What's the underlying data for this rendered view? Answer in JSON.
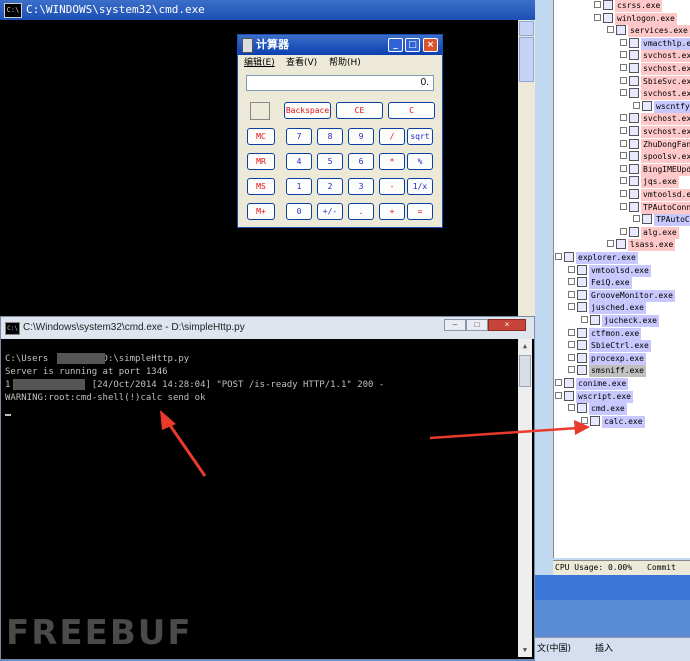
{
  "cmd_top": {
    "title": "C:\\WINDOWS\\system32\\cmd.exe"
  },
  "calculator": {
    "title": "计算器",
    "menus": [
      "编辑(E)",
      "查看(V)",
      "帮助(H)"
    ],
    "display": "0.",
    "top_buttons": [
      "Backspace",
      "CE",
      "C"
    ],
    "rows": [
      [
        "MC",
        "7",
        "8",
        "9",
        "/",
        "sqrt"
      ],
      [
        "MR",
        "4",
        "5",
        "6",
        "*",
        "%"
      ],
      [
        "MS",
        "1",
        "2",
        "3",
        "-",
        "1/x"
      ],
      [
        "M+",
        "0",
        "+/-",
        ".",
        "+",
        "="
      ]
    ],
    "red_buttons": [
      "MC",
      "MR",
      "MS",
      "M+",
      "Backspace",
      "CE",
      "C",
      "/",
      "*",
      "-",
      "+",
      "="
    ]
  },
  "cmd_bottom": {
    "title": "C:\\Windows\\system32\\cmd.exe - D:\\simpleHttp.py",
    "lines": [
      "C:\\Users          D:\\simpleHttp.py",
      "Server is running at port 1346",
      "1           - - [24/Oct/2014 14:28:04] \"POST /is-ready HTTP/1.1\" 200 -",
      "WARNING:root:cmd-shell(!)calc send ok"
    ]
  },
  "process_tree": {
    "items": [
      {
        "name": "csrss.exe",
        "indent": 4,
        "bg": "pink"
      },
      {
        "name": "winlogon.exe",
        "indent": 4,
        "bg": "pink"
      },
      {
        "name": "services.exe",
        "indent": 5,
        "bg": "pink"
      },
      {
        "name": "vmacthlp.exe",
        "indent": 6,
        "bg": "lav"
      },
      {
        "name": "svchost.exe",
        "indent": 6,
        "bg": "pink"
      },
      {
        "name": "svchost.exe",
        "indent": 6,
        "bg": "pink"
      },
      {
        "name": "SbieSvc.exe",
        "indent": 6,
        "bg": "pink"
      },
      {
        "name": "svchost.exe",
        "indent": 6,
        "bg": "pink"
      },
      {
        "name": "wscntfy.exe",
        "indent": 7,
        "bg": "lav"
      },
      {
        "name": "svchost.exe",
        "indent": 6,
        "bg": "pink"
      },
      {
        "name": "svchost.exe",
        "indent": 6,
        "bg": "pink"
      },
      {
        "name": "ZhuDongFangYu.exe",
        "indent": 6,
        "bg": "pink"
      },
      {
        "name": "spoolsv.exe",
        "indent": 6,
        "bg": "pink"
      },
      {
        "name": "BingIMEUpdate.exe",
        "indent": 6,
        "bg": "pink"
      },
      {
        "name": "jqs.exe",
        "indent": 6,
        "bg": "pink"
      },
      {
        "name": "vmtoolsd.exe",
        "indent": 6,
        "bg": "pink"
      },
      {
        "name": "TPAutoConnSvc.exe",
        "indent": 6,
        "bg": "pink"
      },
      {
        "name": "TPAutoConnect.exe",
        "indent": 7,
        "bg": "lav"
      },
      {
        "name": "alg.exe",
        "indent": 6,
        "bg": "pink"
      },
      {
        "name": "lsass.exe",
        "indent": 5,
        "bg": "pink"
      },
      {
        "name": "explorer.exe",
        "indent": 1,
        "bg": "lav"
      },
      {
        "name": "vmtoolsd.exe",
        "indent": 2,
        "bg": "lav"
      },
      {
        "name": "FeiQ.exe",
        "indent": 2,
        "bg": "lav"
      },
      {
        "name": "GrooveMonitor.exe",
        "indent": 2,
        "bg": "lav"
      },
      {
        "name": "jusched.exe",
        "indent": 2,
        "bg": "lav"
      },
      {
        "name": "jucheck.exe",
        "indent": 3,
        "bg": "lav"
      },
      {
        "name": "ctfmon.exe",
        "indent": 2,
        "bg": "lav"
      },
      {
        "name": "SbieCtrl.exe",
        "indent": 2,
        "bg": "lav"
      },
      {
        "name": "procexp.exe",
        "indent": 2,
        "bg": "lav"
      },
      {
        "name": "smsniff.exe",
        "indent": 2,
        "bg": "gray"
      },
      {
        "name": "conime.exe",
        "indent": 1,
        "bg": "lav"
      },
      {
        "name": "wscript.exe",
        "indent": 1,
        "bg": "lav"
      },
      {
        "name": "cmd.exe",
        "indent": 2,
        "bg": "lav"
      },
      {
        "name": "calc.exe",
        "indent": 3,
        "bg": "lav"
      }
    ],
    "status": {
      "cpu": "CPU Usage: 0.00%",
      "commit": "Commit Ch"
    }
  },
  "ime_bar": {
    "lang": "文(中国)",
    "mode": "插入"
  },
  "watermark": "FREEBUF",
  "colors": {
    "arrow": "#ea3a2e",
    "xp_title": "#1c4fb5",
    "calc_red": "#e01010",
    "calc_blue": "#1d2bcc"
  }
}
